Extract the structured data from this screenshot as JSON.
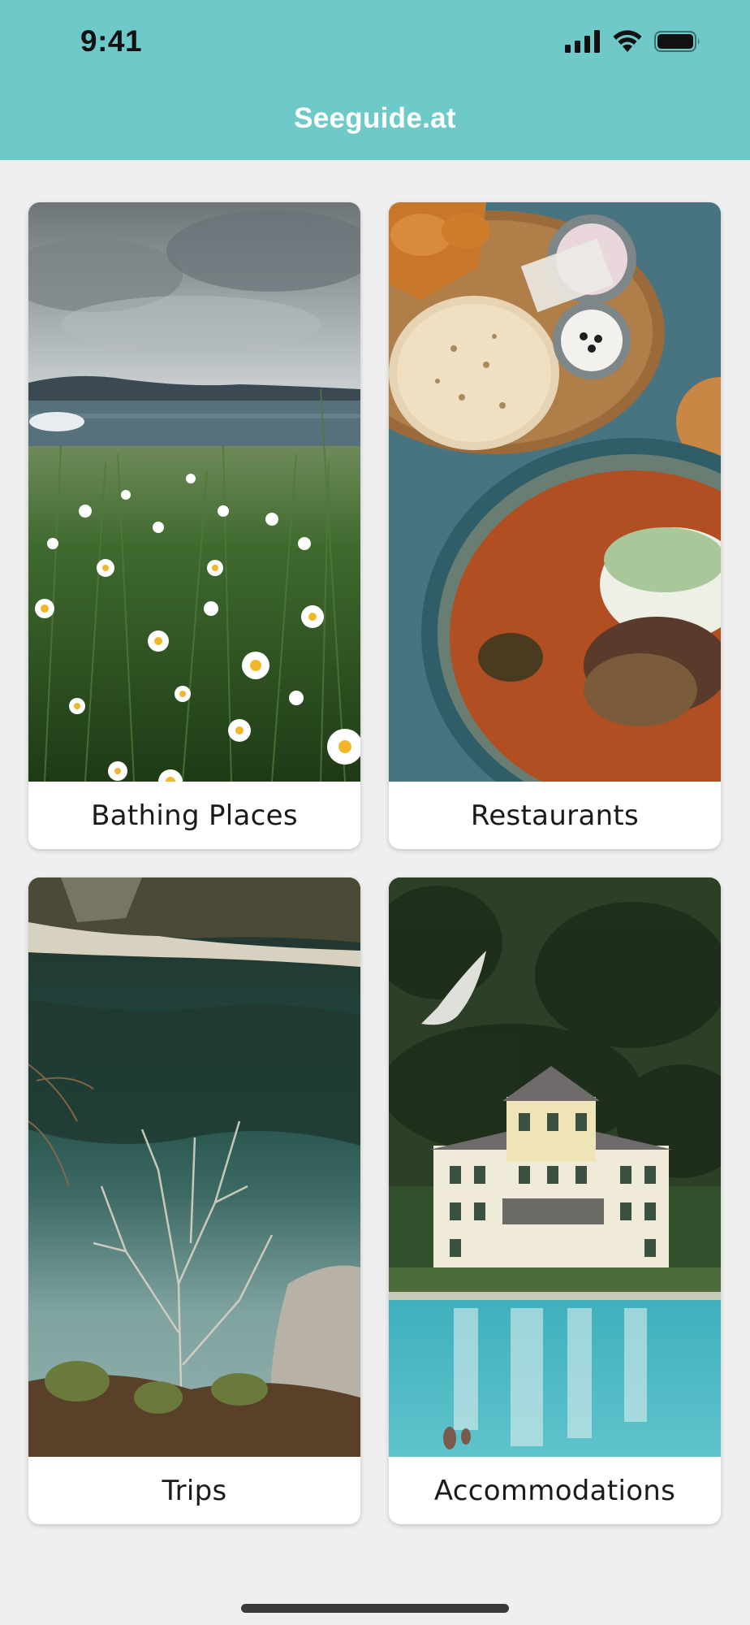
{
  "status_bar": {
    "time": "9:41",
    "icons": [
      "cellular-signal-icon",
      "wifi-icon",
      "battery-icon"
    ]
  },
  "header": {
    "title": "Seeguide.at",
    "background_color": "#6fc9c9"
  },
  "categories": [
    {
      "label": "Bathing Places",
      "image": "lake-meadow-daisies-photo"
    },
    {
      "label": "Restaurants",
      "image": "food-bowl-flatbread-photo"
    },
    {
      "label": "Trips",
      "image": "mountain-lake-reflection-photo"
    },
    {
      "label": "Accommodations",
      "image": "lakeside-hotel-forest-photo"
    }
  ]
}
